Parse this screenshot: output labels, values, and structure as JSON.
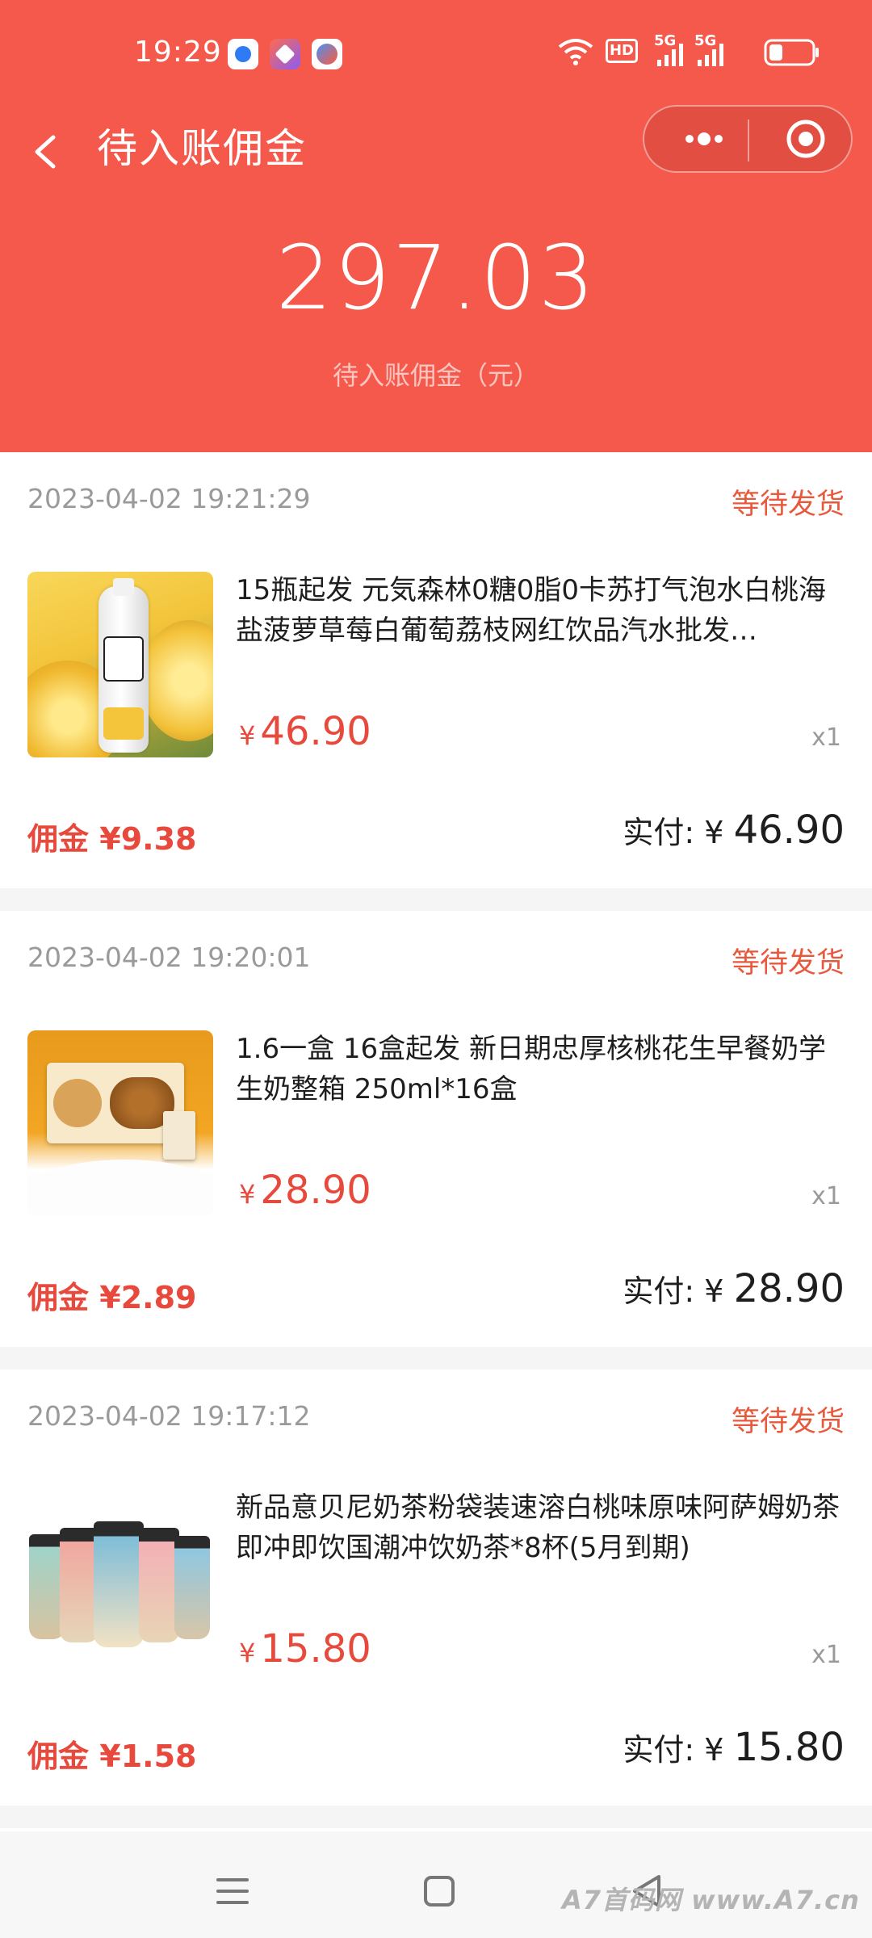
{
  "status_bar": {
    "time": "19:29",
    "network_badge": "HD",
    "signal_label_1": "5G",
    "signal_label_2": "5G"
  },
  "nav": {
    "title": "待入账佣金",
    "back_icon": "chevron-left-icon",
    "more_icon": "more-dots-icon",
    "close_icon": "target-icon"
  },
  "summary": {
    "amount": "297.03",
    "label": "待入账佣金（元）"
  },
  "orders": [
    {
      "time": "2023-04-02 19:21:29",
      "status": "等待发货",
      "title": "15瓶起发 元気森林0糖0脂0卡苏打气泡水白桃海盐菠萝草莓白葡萄荔枝网红饮品汽水批发…",
      "price_symbol": "¥",
      "price": "46.90",
      "quantity": "x1",
      "commission_label": "佣金",
      "commission_symbol": "¥",
      "commission": "9.38",
      "paid_label": "实付:",
      "paid_symbol": "¥",
      "paid": "46.90"
    },
    {
      "time": "2023-04-02 19:20:01",
      "status": "等待发货",
      "title": "1.6一盒 16盒起发 新日期忠厚核桃花生早餐奶学生奶整箱 250ml*16盒",
      "price_symbol": "¥",
      "price": "28.90",
      "quantity": "x1",
      "commission_label": "佣金",
      "commission_symbol": "¥",
      "commission": "2.89",
      "paid_label": "实付:",
      "paid_symbol": "¥",
      "paid": "28.90"
    },
    {
      "time": "2023-04-02 19:17:12",
      "status": "等待发货",
      "title": "新品意贝尼奶茶粉袋装速溶白桃味原味阿萨姆奶茶即冲即饮国潮冲饮奶茶*8杯(5月到期)",
      "price_symbol": "¥",
      "price": "15.80",
      "quantity": "x1",
      "commission_label": "佣金",
      "commission_symbol": "¥",
      "commission": "1.58",
      "paid_label": "实付:",
      "paid_symbol": "¥",
      "paid": "15.80"
    }
  ],
  "watermark": "A7首码网  www.A7.cn",
  "colors": {
    "header_bg": "#f4594c",
    "price_red": "#e8493d",
    "status_orange": "#e8583c"
  }
}
